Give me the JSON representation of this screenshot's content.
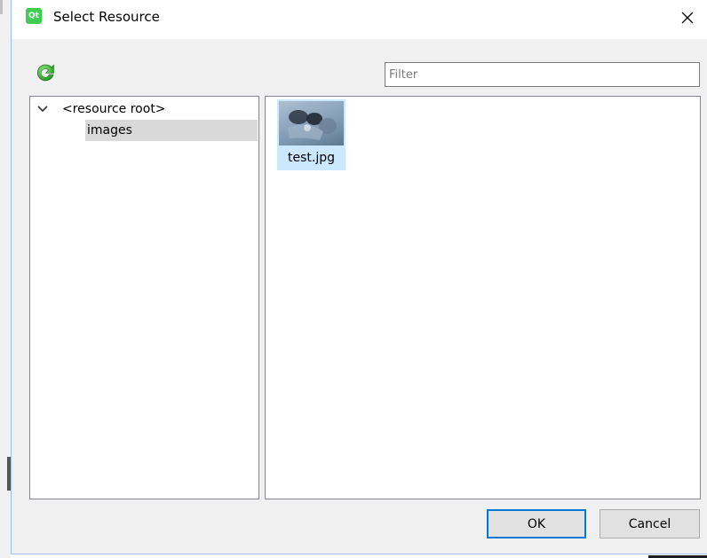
{
  "window": {
    "title": "Select Resource",
    "app_icon_text": "Qt",
    "close_glyph": "✕"
  },
  "toolbar": {
    "reload_icon": "reload-icon",
    "filter_placeholder": "Filter",
    "filter_value": ""
  },
  "tree": {
    "root_label": "<resource root>",
    "children": [
      {
        "label": "images",
        "selected": true
      }
    ]
  },
  "files": [
    {
      "name": "test.jpg",
      "selected": true
    }
  ],
  "buttons": {
    "ok_label": "OK",
    "cancel_label": "Cancel"
  },
  "colors": {
    "accent": "#0078d7",
    "selection": "#cce8ff",
    "tree_selection": "#d9d9d9",
    "qt_green": "#41cd52"
  }
}
